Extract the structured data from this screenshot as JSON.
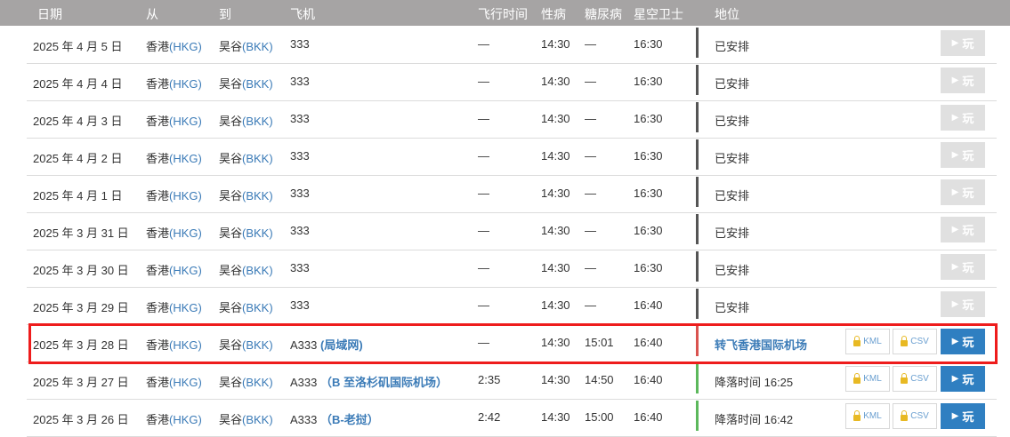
{
  "columns": {
    "date": "日期",
    "from": "从",
    "to": "到",
    "aircraft": "飞机",
    "flight_time": "飞行时间",
    "col_std": "性病",
    "col_atd": "糖尿病",
    "col_sta": "星空卫士",
    "status": "地位"
  },
  "buttons": {
    "play": "玩",
    "kml": "KML",
    "csv": "CSV"
  },
  "rows": [
    {
      "date": "2025 年 4 月 5 日",
      "from_city": "香港",
      "from_code": "(HKG)",
      "to_city": "昊谷",
      "to_code": "(BKK)",
      "aircraft": "333",
      "aircraft_link": "",
      "flight_time": "—",
      "std": "14:30",
      "atd": "—",
      "sta": "16:30",
      "status": "已安排",
      "status_type": "scheduled",
      "status_color": "#555555"
    },
    {
      "date": "2025 年 4 月 4 日",
      "from_city": "香港",
      "from_code": "(HKG)",
      "to_city": "昊谷",
      "to_code": "(BKK)",
      "aircraft": "333",
      "aircraft_link": "",
      "flight_time": "—",
      "std": "14:30",
      "atd": "—",
      "sta": "16:30",
      "status": "已安排",
      "status_type": "scheduled",
      "status_color": "#555555"
    },
    {
      "date": "2025 年 4 月 3 日",
      "from_city": "香港",
      "from_code": "(HKG)",
      "to_city": "昊谷",
      "to_code": "(BKK)",
      "aircraft": "333",
      "aircraft_link": "",
      "flight_time": "—",
      "std": "14:30",
      "atd": "—",
      "sta": "16:30",
      "status": "已安排",
      "status_type": "scheduled",
      "status_color": "#555555"
    },
    {
      "date": "2025 年 4 月 2 日",
      "from_city": "香港",
      "from_code": "(HKG)",
      "to_city": "昊谷",
      "to_code": "(BKK)",
      "aircraft": "333",
      "aircraft_link": "",
      "flight_time": "—",
      "std": "14:30",
      "atd": "—",
      "sta": "16:30",
      "status": "已安排",
      "status_type": "scheduled",
      "status_color": "#555555"
    },
    {
      "date": "2025 年 4 月 1 日",
      "from_city": "香港",
      "from_code": "(HKG)",
      "to_city": "昊谷",
      "to_code": "(BKK)",
      "aircraft": "333",
      "aircraft_link": "",
      "flight_time": "—",
      "std": "14:30",
      "atd": "—",
      "sta": "16:30",
      "status": "已安排",
      "status_type": "scheduled",
      "status_color": "#555555"
    },
    {
      "date": "2025 年 3 月 31 日",
      "from_city": "香港",
      "from_code": "(HKG)",
      "to_city": "昊谷",
      "to_code": "(BKK)",
      "aircraft": "333",
      "aircraft_link": "",
      "flight_time": "—",
      "std": "14:30",
      "atd": "—",
      "sta": "16:30",
      "status": "已安排",
      "status_type": "scheduled",
      "status_color": "#555555"
    },
    {
      "date": "2025 年 3 月 30 日",
      "from_city": "香港",
      "from_code": "(HKG)",
      "to_city": "昊谷",
      "to_code": "(BKK)",
      "aircraft": "333",
      "aircraft_link": "",
      "flight_time": "—",
      "std": "14:30",
      "atd": "—",
      "sta": "16:30",
      "status": "已安排",
      "status_type": "scheduled",
      "status_color": "#555555"
    },
    {
      "date": "2025 年 3 月 29 日",
      "from_city": "香港",
      "from_code": "(HKG)",
      "to_city": "昊谷",
      "to_code": "(BKK)",
      "aircraft": "333",
      "aircraft_link": "",
      "flight_time": "—",
      "std": "14:30",
      "atd": "—",
      "sta": "16:40",
      "status": "已安排",
      "status_type": "scheduled",
      "status_color": "#555555"
    },
    {
      "date": "2025 年 3 月 28 日",
      "from_city": "香港",
      "from_code": "(HKG)",
      "to_city": "昊谷",
      "to_code": "(BKK)",
      "aircraft": "A333",
      "aircraft_link": "(局域网)",
      "flight_time": "—",
      "std": "14:30",
      "atd": "15:01",
      "sta": "16:40",
      "status": "转飞香港国际机场",
      "status_type": "diverted",
      "status_color": "#d9534f"
    },
    {
      "date": "2025 年 3 月 27 日",
      "from_city": "香港",
      "from_code": "(HKG)",
      "to_city": "昊谷",
      "to_code": "(BKK)",
      "aircraft": "A333",
      "aircraft_link": "（B 至洛杉矶国际机场）",
      "flight_time": "2:35",
      "std": "14:30",
      "atd": "14:50",
      "sta": "16:40",
      "status": "降落时间 16:25",
      "status_type": "landed",
      "status_color": "#5cb85c"
    },
    {
      "date": "2025 年 3 月 26 日",
      "from_city": "香港",
      "from_code": "(HKG)",
      "to_city": "昊谷",
      "to_code": "(BKK)",
      "aircraft": "A333",
      "aircraft_link": "（B-老挝）",
      "flight_time": "2:42",
      "std": "14:30",
      "atd": "15:00",
      "sta": "16:40",
      "status": "降落时间 16:42",
      "status_type": "landed",
      "status_color": "#5cb85c"
    }
  ]
}
